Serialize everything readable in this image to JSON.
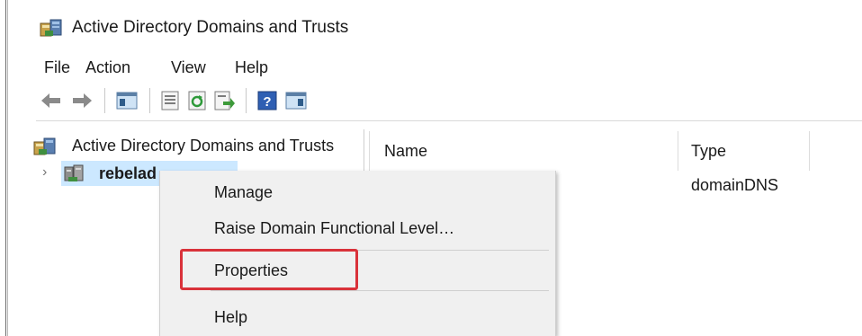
{
  "window": {
    "title": "Active Directory Domains and Trusts"
  },
  "menu": [
    "File",
    "Action",
    "View",
    "Help"
  ],
  "toolbar": {
    "buttons": [
      "back-icon",
      "forward-icon",
      "show-hide-console-tree-icon",
      "properties-icon",
      "refresh-icon",
      "export-list-icon",
      "help-icon",
      "show-hide-action-pane-icon"
    ]
  },
  "tree": {
    "root": "Active Directory Domains and Trusts",
    "child": "rebelad",
    "expander": "›"
  },
  "list": {
    "columns": [
      "Name",
      "Type"
    ],
    "rows": [
      {
        "name": "",
        "type": "domainDNS"
      }
    ]
  },
  "context_menu": {
    "items": [
      "Manage",
      "Raise Domain Functional Level…",
      "Properties",
      "Help"
    ]
  },
  "colors": {
    "highlight": "#d9323a",
    "selection": "#cce8ff",
    "menu_bg": "#f0f0f0"
  }
}
